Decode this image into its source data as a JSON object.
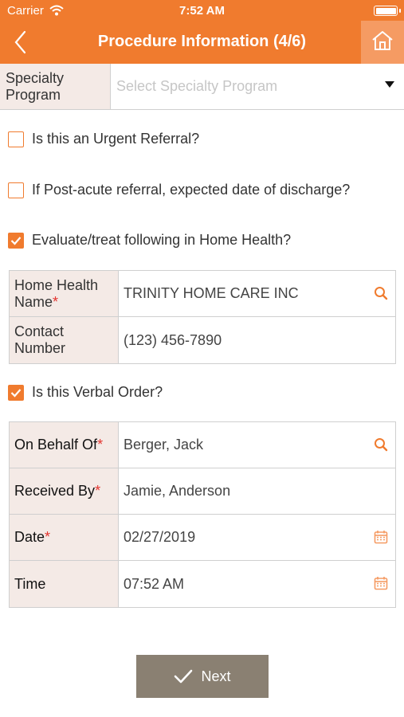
{
  "status": {
    "carrier": "Carrier",
    "time": "7:52 AM"
  },
  "nav": {
    "title": "Procedure Information (4/6)"
  },
  "specialty": {
    "label": "Specialty Program",
    "placeholder": "Select Specialty Program"
  },
  "checks": {
    "urgent": {
      "label": "Is this an Urgent Referral?",
      "checked": false
    },
    "post_acute": {
      "label": "If Post-acute referral, expected date of discharge?",
      "checked": false
    },
    "home_health": {
      "label": "Evaluate/treat following in Home Health?",
      "checked": true
    },
    "verbal": {
      "label": "Is this Verbal Order?",
      "checked": true
    }
  },
  "home_health": {
    "name_label": "Home Health Name",
    "name_value": "TRINITY HOME CARE INC",
    "contact_label": "Contact Number",
    "contact_value": "(123) 456-7890"
  },
  "verbal": {
    "behalf_label": "On Behalf Of",
    "behalf_value": "Berger, Jack",
    "received_label": "Received By",
    "received_value": "Jamie, Anderson",
    "date_label": "Date",
    "date_value": "02/27/2019",
    "time_label": "Time",
    "time_value": "07:52 AM"
  },
  "required_mark": "*",
  "buttons": {
    "next": "Next"
  },
  "colors": {
    "accent": "#f07b2e",
    "label_bg": "#f4eae6",
    "button": "#8a8072",
    "required": "#e3342f"
  },
  "icons": [
    "wifi-icon",
    "battery-icon",
    "back-chevron-icon",
    "home-icon",
    "dropdown-caret-icon",
    "search-icon",
    "calendar-icon",
    "checkmark-icon"
  ]
}
